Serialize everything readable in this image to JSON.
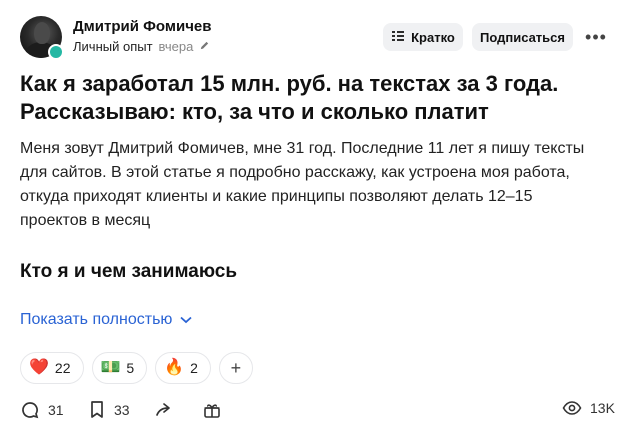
{
  "author": {
    "name": "Дмитрий Фомичев",
    "category": "Личный опыт",
    "time": "вчера"
  },
  "actions": {
    "brief_label": "Кратко",
    "subscribe_label": "Подписаться",
    "more_label": "•••"
  },
  "article": {
    "title": "Как я заработал 15 млн. руб. на текстах за 3 года. Рассказываю: кто, за что и сколько платит",
    "lead": "Меня зовут Дмитрий Фомичев, мне 31 год. Последние 11 лет я пишу тексты для сайтов. В этой статье я подробно расскажу, как устроена моя работа, откуда приходят клиенты и какие принципы позволяют делать 12–15 проектов в месяц",
    "subheading": "Кто я и чем занимаюсь",
    "show_more": "Показать полностью"
  },
  "reactions": [
    {
      "emoji": "❤️",
      "count": "22",
      "icon": "heart-icon"
    },
    {
      "emoji": "💵",
      "count": "5",
      "icon": "money-icon"
    },
    {
      "emoji": "🔥",
      "count": "2",
      "icon": "fire-icon"
    }
  ],
  "reaction_add": "+",
  "footer": {
    "comments": "31",
    "bookmarks": "33",
    "views": "13K"
  },
  "colors": {
    "link": "#2a63d4",
    "button_bg": "#f0f1f3",
    "badge": "#25b8a4"
  }
}
